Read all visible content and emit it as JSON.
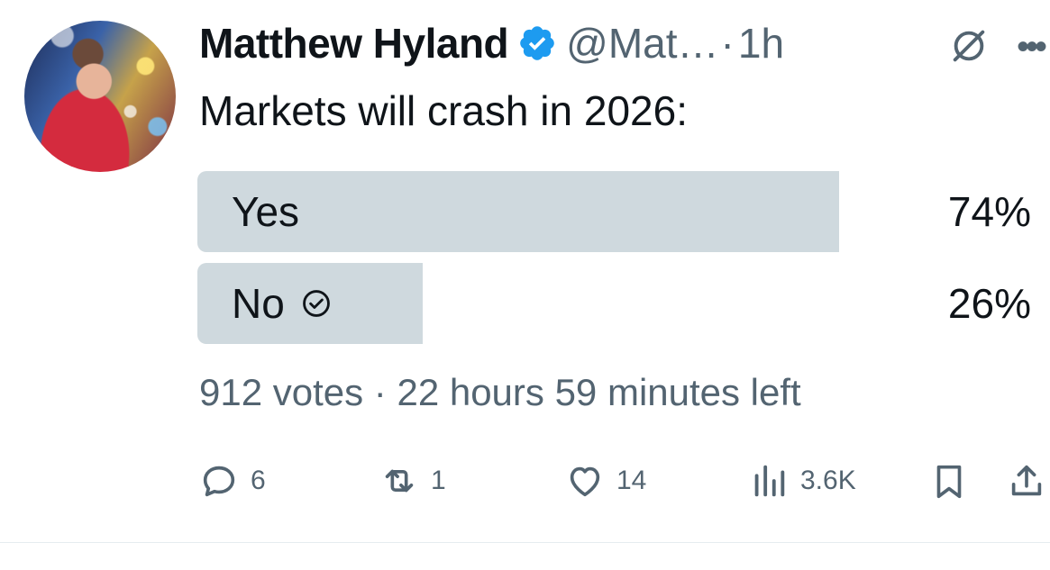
{
  "author": {
    "name": "Matthew Hyland",
    "handle": "@Mat…",
    "separator": "·",
    "time": "1h"
  },
  "tweet": {
    "text": "Markets will crash in 2026:"
  },
  "poll": {
    "options": [
      {
        "label": "Yes",
        "percent": "74%",
        "fraction": 0.74,
        "selected": false
      },
      {
        "label": "No",
        "percent": "26%",
        "fraction": 0.26,
        "selected": true
      }
    ],
    "meta": "912 votes · 22 hours 59 minutes left"
  },
  "actions": {
    "replies": "6",
    "reposts": "1",
    "likes": "14",
    "views": "3.6K"
  },
  "icons": [
    "verified-badge-icon",
    "grok-icon",
    "more-icon",
    "check-circle-icon",
    "reply-icon",
    "repost-icon",
    "like-icon",
    "views-icon",
    "bookmark-icon",
    "share-icon"
  ],
  "colors": {
    "verified": "#1d9bf0",
    "bar": "#cfd9de",
    "secondary_text": "#536471"
  }
}
